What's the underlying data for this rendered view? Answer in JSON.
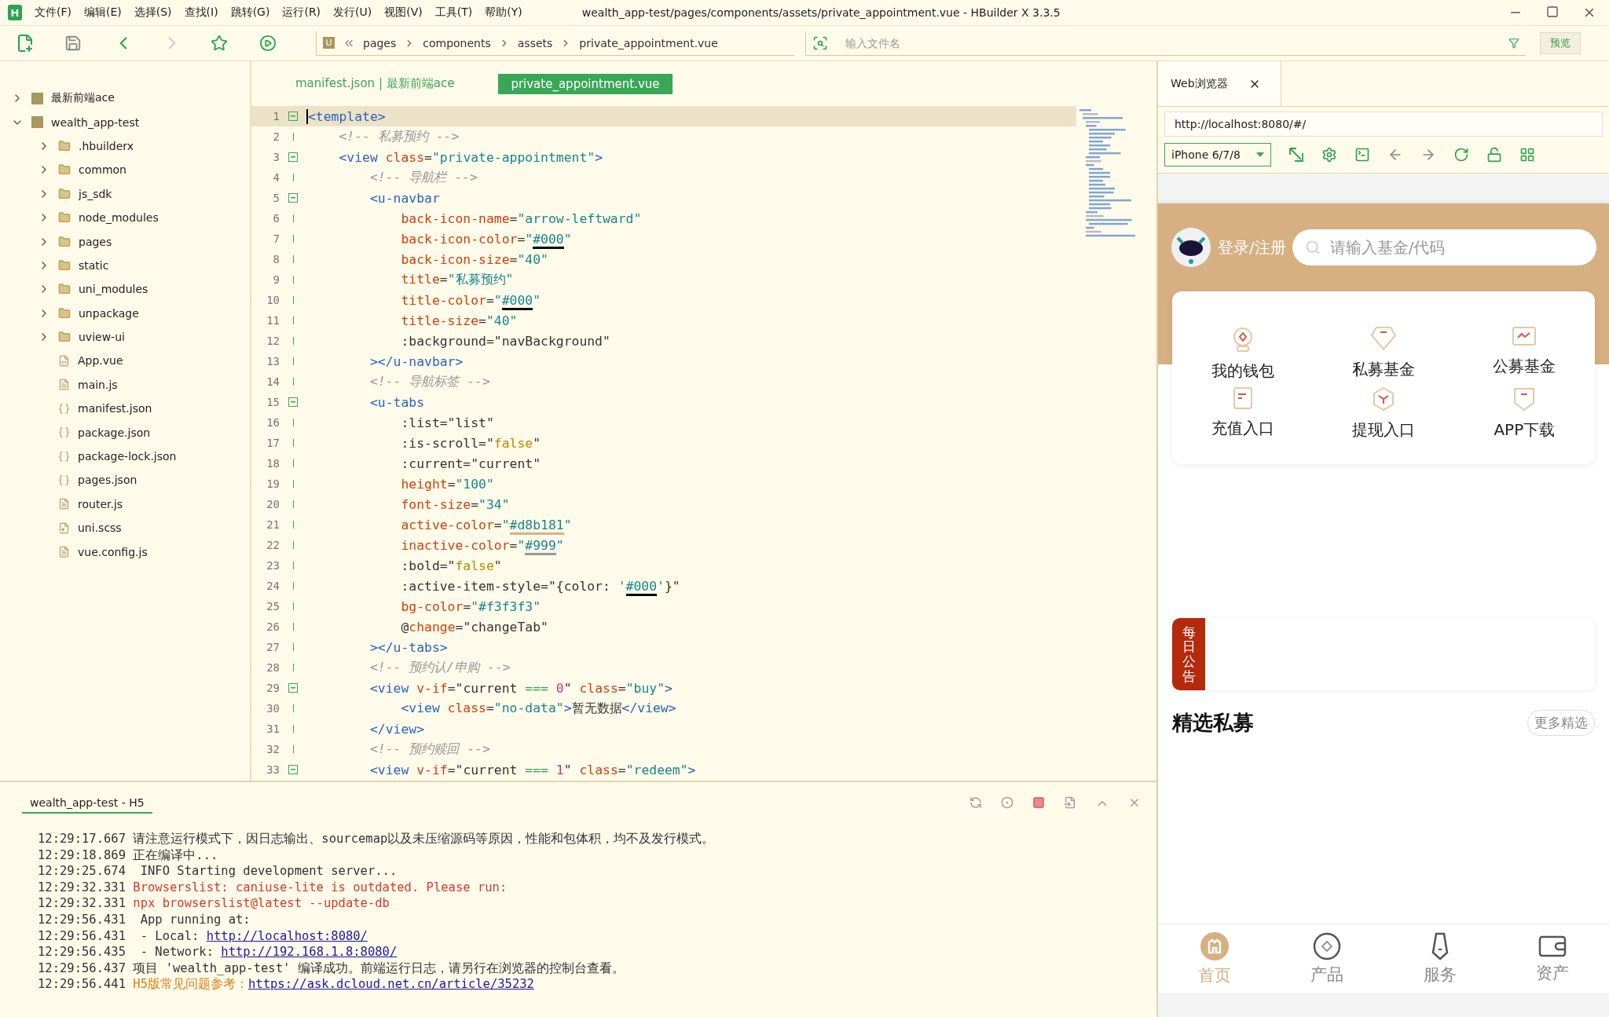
{
  "menu_bar": {
    "logo": "H",
    "items": [
      "文件(F)",
      "编辑(E)",
      "选择(S)",
      "查找(I)",
      "跳转(G)",
      "运行(R)",
      "发行(U)",
      "视图(V)",
      "工具(T)",
      "帮助(Y)"
    ],
    "window_title": "wealth_app-test/pages/components/assets/private_appointment.vue - HBuilder X 3.3.5"
  },
  "toolbar": {
    "breadcrumb_badge": "U",
    "breadcrumb": [
      "pages",
      "components",
      "assets",
      "private_appointment.vue"
    ],
    "file_search": {
      "placeholder": "输入文件名"
    },
    "preview_button": "预览"
  },
  "project_tree": [
    {
      "name": "最新前端ace",
      "kind": "project",
      "expanded": false
    },
    {
      "name": "wealth_app-test",
      "kind": "project",
      "expanded": true,
      "children": [
        {
          "name": ".hbuilderx",
          "kind": "folder",
          "expanded": false
        },
        {
          "name": "common",
          "kind": "folder",
          "expanded": false
        },
        {
          "name": "js_sdk",
          "kind": "folder",
          "expanded": false
        },
        {
          "name": "node_modules",
          "kind": "folder",
          "expanded": false
        },
        {
          "name": "pages",
          "kind": "folder",
          "expanded": false
        },
        {
          "name": "static",
          "kind": "folder",
          "expanded": false
        },
        {
          "name": "uni_modules",
          "kind": "folder",
          "expanded": false
        },
        {
          "name": "unpackage",
          "kind": "folder",
          "expanded": false
        },
        {
          "name": "uview-ui",
          "kind": "folder",
          "expanded": false
        },
        {
          "name": "App.vue",
          "kind": "vue"
        },
        {
          "name": "main.js",
          "kind": "file"
        },
        {
          "name": "manifest.json",
          "kind": "manifest"
        },
        {
          "name": "package.json",
          "kind": "json"
        },
        {
          "name": "package-lock.json",
          "kind": "json"
        },
        {
          "name": "pages.json",
          "kind": "json"
        },
        {
          "name": "router.js",
          "kind": "file"
        },
        {
          "name": "uni.scss",
          "kind": "style"
        },
        {
          "name": "vue.config.js",
          "kind": "file"
        }
      ]
    }
  ],
  "editor": {
    "tabs": [
      {
        "label": "manifest.json | 最新前端ace",
        "selected": false
      },
      {
        "label": "private_appointment.vue",
        "selected": true
      }
    ],
    "lines": [
      {
        "number": "1",
        "expanded": true,
        "current": true,
        "segments": [
          {
            "kind": "tag",
            "text": "<template>"
          }
        ]
      },
      {
        "number": "2",
        "current": false,
        "segments": [
          {
            "kind": "comment",
            "text": "    <!-- 私募预约 -->"
          }
        ]
      },
      {
        "number": "3",
        "expanded": true,
        "current": false,
        "segments": [
          {
            "kind": "tag",
            "text": "    <view "
          },
          {
            "kind": "attr",
            "text": "class"
          },
          {
            "kind": "plain",
            "text": "="
          },
          {
            "kind": "str",
            "text": "\"private-appointment\""
          },
          {
            "kind": "tag",
            "text": ">"
          }
        ]
      },
      {
        "number": "4",
        "current": false,
        "segments": [
          {
            "kind": "comment",
            "text": "        <!-- 导航栏 -->"
          }
        ]
      },
      {
        "number": "5",
        "expanded": true,
        "current": false,
        "segments": [
          {
            "kind": "tag",
            "text": "        <u-navbar"
          }
        ]
      },
      {
        "number": "6",
        "current": false,
        "segments": [
          {
            "kind": "attr",
            "text": "            back-icon-name"
          },
          {
            "kind": "plain",
            "text": "="
          },
          {
            "kind": "str",
            "text": "\"arrow-leftward\""
          }
        ]
      },
      {
        "number": "7",
        "current": false,
        "segments": [
          {
            "kind": "attr",
            "text": "            back-icon-color"
          },
          {
            "kind": "plain",
            "text": "="
          },
          {
            "kind": "str",
            "text": "\""
          },
          {
            "kind": "str",
            "text": "#000",
            "color": "#000000"
          },
          {
            "kind": "str",
            "text": "\""
          }
        ]
      },
      {
        "number": "8",
        "current": false,
        "segments": [
          {
            "kind": "attr",
            "text": "            back-icon-size"
          },
          {
            "kind": "plain",
            "text": "="
          },
          {
            "kind": "str",
            "text": "\"40\""
          }
        ]
      },
      {
        "number": "9",
        "current": false,
        "segments": [
          {
            "kind": "attr",
            "text": "            title"
          },
          {
            "kind": "plain",
            "text": "="
          },
          {
            "kind": "str",
            "text": "\"私募预约\""
          }
        ]
      },
      {
        "number": "10",
        "current": false,
        "segments": [
          {
            "kind": "attr",
            "text": "            title-color"
          },
          {
            "kind": "plain",
            "text": "="
          },
          {
            "kind": "str",
            "text": "\""
          },
          {
            "kind": "str",
            "text": "#000",
            "color": "#000000"
          },
          {
            "kind": "str",
            "text": "\""
          }
        ]
      },
      {
        "number": "11",
        "current": false,
        "segments": [
          {
            "kind": "attr",
            "text": "            title-size"
          },
          {
            "kind": "plain",
            "text": "="
          },
          {
            "kind": "str",
            "text": "\"40\""
          }
        ]
      },
      {
        "number": "12",
        "current": false,
        "segments": [
          {
            "kind": "plain",
            "text": "            :background=\"navBackground\""
          }
        ]
      },
      {
        "number": "13",
        "current": false,
        "segments": [
          {
            "kind": "tag",
            "text": "        ></u-navbar>"
          }
        ]
      },
      {
        "number": "14",
        "current": false,
        "segments": [
          {
            "kind": "comment",
            "text": "        <!-- 导航标签 -->"
          }
        ]
      },
      {
        "number": "15",
        "expanded": true,
        "current": false,
        "segments": [
          {
            "kind": "tag",
            "text": "        <u-tabs"
          }
        ]
      },
      {
        "number": "16",
        "current": false,
        "segments": [
          {
            "kind": "plain",
            "text": "            :list=\"list\""
          }
        ]
      },
      {
        "number": "17",
        "current": false,
        "segments": [
          {
            "kind": "plain",
            "text": "            :is-scroll=\""
          },
          {
            "kind": "bool",
            "text": "false"
          },
          {
            "kind": "plain",
            "text": "\""
          }
        ]
      },
      {
        "number": "18",
        "current": false,
        "segments": [
          {
            "kind": "plain",
            "text": "            :current=\"current\""
          }
        ]
      },
      {
        "number": "19",
        "current": false,
        "segments": [
          {
            "kind": "attr",
            "text": "            height"
          },
          {
            "kind": "plain",
            "text": "="
          },
          {
            "kind": "str",
            "text": "\"100\""
          }
        ]
      },
      {
        "number": "20",
        "current": false,
        "segments": [
          {
            "kind": "attr",
            "text": "            font-size"
          },
          {
            "kind": "plain",
            "text": "="
          },
          {
            "kind": "str",
            "text": "\"34\""
          }
        ]
      },
      {
        "number": "21",
        "current": false,
        "segments": [
          {
            "kind": "attr",
            "text": "            active-color"
          },
          {
            "kind": "plain",
            "text": "="
          },
          {
            "kind": "str",
            "text": "\""
          },
          {
            "kind": "str",
            "text": "#d8b181",
            "color": "#d8b181"
          },
          {
            "kind": "str",
            "text": "\""
          }
        ]
      },
      {
        "number": "22",
        "current": false,
        "segments": [
          {
            "kind": "attr",
            "text": "            inactive-color"
          },
          {
            "kind": "plain",
            "text": "="
          },
          {
            "kind": "str",
            "text": "\""
          },
          {
            "kind": "str",
            "text": "#999",
            "color": "#999999"
          },
          {
            "kind": "str",
            "text": "\""
          }
        ]
      },
      {
        "number": "23",
        "current": false,
        "segments": [
          {
            "kind": "plain",
            "text": "            :bold=\""
          },
          {
            "kind": "bool",
            "text": "false"
          },
          {
            "kind": "plain",
            "text": "\""
          }
        ]
      },
      {
        "number": "24",
        "current": false,
        "segments": [
          {
            "kind": "plain",
            "text": "            :active-item-style=\"{color: "
          },
          {
            "kind": "str",
            "text": "'"
          },
          {
            "kind": "str",
            "text": "#000",
            "color": "#000000"
          },
          {
            "kind": "str",
            "text": "'"
          },
          {
            "kind": "plain",
            "text": "}\""
          }
        ]
      },
      {
        "number": "25",
        "current": false,
        "segments": [
          {
            "kind": "attr",
            "text": "            bg-color"
          },
          {
            "kind": "plain",
            "text": "="
          },
          {
            "kind": "str",
            "text": "\"#f3f3f3\""
          }
        ]
      },
      {
        "number": "26",
        "current": false,
        "segments": [
          {
            "kind": "plain",
            "text": "            @"
          },
          {
            "kind": "attr",
            "text": "change"
          },
          {
            "kind": "plain",
            "text": "=\"changeTab\""
          }
        ]
      },
      {
        "number": "27",
        "current": false,
        "segments": [
          {
            "kind": "tag",
            "text": "        ></u-tabs>"
          }
        ]
      },
      {
        "number": "28",
        "current": false,
        "segments": [
          {
            "kind": "comment",
            "text": "        <!-- 预约认/申购 -->"
          }
        ]
      },
      {
        "number": "29",
        "expanded": true,
        "current": false,
        "segments": [
          {
            "kind": "tag",
            "text": "        <view "
          },
          {
            "kind": "attr",
            "text": "v-if"
          },
          {
            "kind": "plain",
            "text": "=\"current "
          },
          {
            "kind": "op",
            "text": "==="
          },
          {
            "kind": "num",
            "text": " 0"
          },
          {
            "kind": "plain",
            "text": "\" "
          },
          {
            "kind": "attr",
            "text": "class"
          },
          {
            "kind": "plain",
            "text": "="
          },
          {
            "kind": "str",
            "text": "\"buy\""
          },
          {
            "kind": "tag",
            "text": ">"
          }
        ]
      },
      {
        "number": "30",
        "current": false,
        "segments": [
          {
            "kind": "tag",
            "text": "            <view "
          },
          {
            "kind": "attr",
            "text": "class"
          },
          {
            "kind": "plain",
            "text": "="
          },
          {
            "kind": "str",
            "text": "\"no-data\""
          },
          {
            "kind": "tag",
            "text": ">"
          },
          {
            "kind": "plain",
            "text": "暂无数据"
          },
          {
            "kind": "tag",
            "text": "</view>"
          }
        ]
      },
      {
        "number": "31",
        "current": false,
        "segments": [
          {
            "kind": "tag",
            "text": "        </view>"
          }
        ]
      },
      {
        "number": "32",
        "current": false,
        "segments": [
          {
            "kind": "comment",
            "text": "        <!-- 预约赎回 -->"
          }
        ]
      },
      {
        "number": "33",
        "expanded": true,
        "current": false,
        "segments": [
          {
            "kind": "tag",
            "text": "        <view "
          },
          {
            "kind": "attr",
            "text": "v-if"
          },
          {
            "kind": "plain",
            "text": "=\"current "
          },
          {
            "kind": "op",
            "text": "==="
          },
          {
            "kind": "num",
            "text": " 1"
          },
          {
            "kind": "plain",
            "text": "\" "
          },
          {
            "kind": "attr",
            "text": "class"
          },
          {
            "kind": "plain",
            "text": "="
          },
          {
            "kind": "str",
            "text": "\"redeem\""
          },
          {
            "kind": "tag",
            "text": ">"
          }
        ]
      }
    ]
  },
  "console": {
    "tab": "wealth_app-test - H5",
    "lines": [
      {
        "time": "12:29:17.667",
        "segments": [
          {
            "kind": "plain",
            "text": "请注意运行模式下，因日志输出、sourcemap以及未压缩源码等原因，性能和包体积，均不及发行模式。"
          }
        ]
      },
      {
        "time": "12:29:18.869",
        "segments": [
          {
            "kind": "plain",
            "text": "正在编译中..."
          }
        ]
      },
      {
        "time": "12:29:25.674",
        "segments": [
          {
            "kind": "plain",
            "text": " INFO  Starting development server..."
          }
        ]
      },
      {
        "time": "12:29:32.331",
        "segments": [
          {
            "kind": "error",
            "text": "Browserslist: caniuse-lite is outdated. Please run:"
          }
        ]
      },
      {
        "time": "12:29:32.331",
        "segments": [
          {
            "kind": "error",
            "text": "npx browserslist@latest --update-db"
          }
        ]
      },
      {
        "time": "12:29:56.431",
        "segments": [
          {
            "kind": "plain",
            "text": "  App running at:"
          }
        ]
      },
      {
        "time": "12:29:56.431",
        "segments": [
          {
            "kind": "plain",
            "text": "  - Local:   "
          },
          {
            "kind": "link",
            "text": "http://localhost:8080/"
          }
        ]
      },
      {
        "time": "12:29:56.435",
        "segments": [
          {
            "kind": "plain",
            "text": "  - Network: "
          },
          {
            "kind": "link",
            "text": "http://192.168.1.8:8080/"
          }
        ]
      },
      {
        "time": "12:29:56.437",
        "segments": [
          {
            "kind": "plain",
            "text": "项目 'wealth_app-test' 编译成功。前端运行日志，请另行在浏览器的控制台查看。"
          }
        ]
      },
      {
        "time": "12:29:56.441",
        "segments": [
          {
            "kind": "warn",
            "text": "H5版常见问题参考："
          },
          {
            "kind": "link",
            "text": "https://ask.dcloud.net.cn/article/35232"
          }
        ]
      }
    ]
  },
  "browser": {
    "tab": "Web浏览器",
    "url": "http://localhost:8080/#/",
    "device": "iPhone 6/7/8",
    "app": {
      "login": "登录/注册",
      "search": {
        "placeholder": "请输入基金/代码"
      },
      "shortcuts": [
        "我的钱包",
        "私募基金",
        "公募基金",
        "充值入口",
        "提现入口",
        "APP下载"
      ],
      "notice_label": "每日公告",
      "section_title": "精选私募",
      "more_button": "更多精选",
      "tab_bar": [
        {
          "label": "首页",
          "selected": true
        },
        {
          "label": "产品",
          "selected": false
        },
        {
          "label": "服务",
          "selected": false
        },
        {
          "label": "资产",
          "selected": false
        }
      ]
    }
  }
}
